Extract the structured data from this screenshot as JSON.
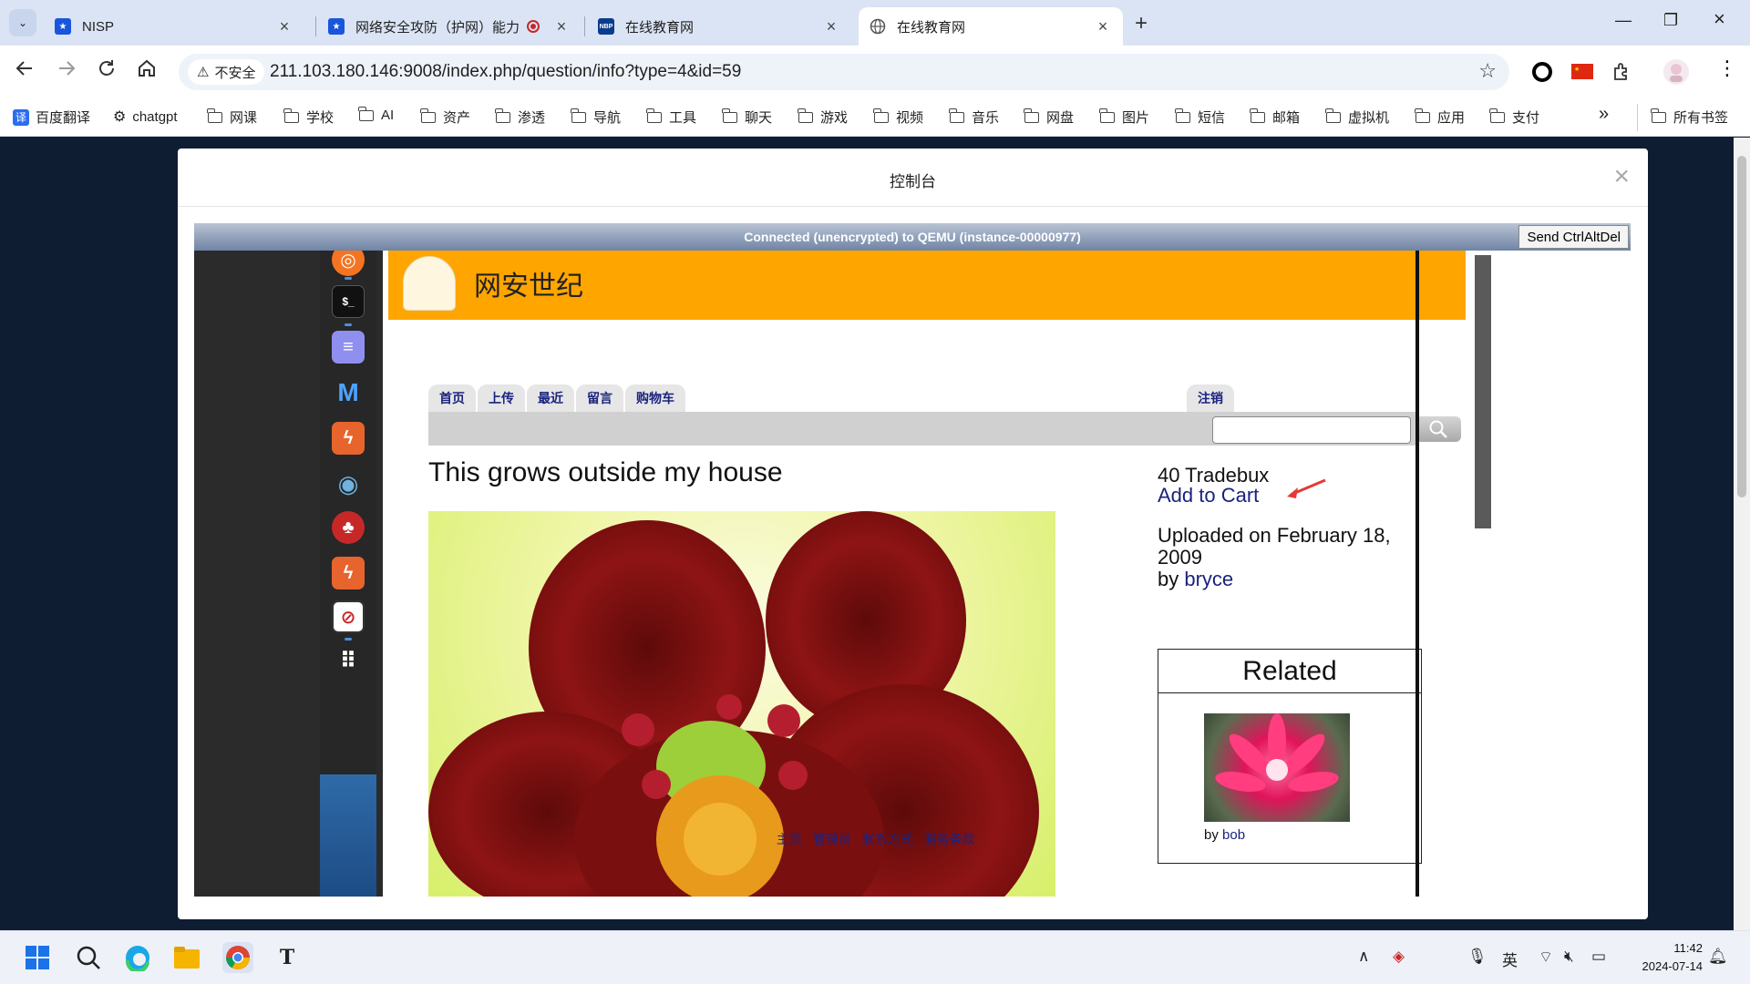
{
  "browser": {
    "tabs": [
      {
        "title": "NISP",
        "favicon_color": "#1a56db"
      },
      {
        "title": "网络安全攻防（护网）能力",
        "favicon_color": "#1a56db",
        "recording": true
      },
      {
        "title": "在线教育网",
        "favicon_label": "NBP",
        "favicon_color": "#0a3c8c"
      },
      {
        "title": "在线教育网",
        "active": true
      }
    ],
    "omnibox": {
      "insecure_label": "不安全",
      "url": "211.103.180.146:9008/index.php/question/info?type=4&id=59"
    },
    "bookmarks": [
      {
        "label": "百度翻译",
        "kind": "translate-icon"
      },
      {
        "label": "chatgpt",
        "kind": "openai-icon"
      },
      {
        "label": "网课",
        "kind": "folder"
      },
      {
        "label": "学校",
        "kind": "folder"
      },
      {
        "label": "AI",
        "kind": "folder"
      },
      {
        "label": "资产",
        "kind": "folder"
      },
      {
        "label": "渗透",
        "kind": "folder"
      },
      {
        "label": "导航",
        "kind": "folder"
      },
      {
        "label": "工具",
        "kind": "folder"
      },
      {
        "label": "聊天",
        "kind": "folder"
      },
      {
        "label": "游戏",
        "kind": "folder"
      },
      {
        "label": "视频",
        "kind": "folder"
      },
      {
        "label": "音乐",
        "kind": "folder"
      },
      {
        "label": "网盘",
        "kind": "folder"
      },
      {
        "label": "图片",
        "kind": "folder"
      },
      {
        "label": "短信",
        "kind": "folder"
      },
      {
        "label": "邮箱",
        "kind": "folder"
      },
      {
        "label": "虚拟机",
        "kind": "folder"
      },
      {
        "label": "应用",
        "kind": "folder"
      },
      {
        "label": "支付",
        "kind": "folder"
      }
    ],
    "overflow_label": "»",
    "all_bookmarks_label": "所有书签"
  },
  "modal": {
    "title": "控制台",
    "close_glyph": "×"
  },
  "vnc": {
    "status": "Connected (unencrypted) to QEMU (instance-00000977)",
    "send_button": "Send CtrlAltDel"
  },
  "guest_page": {
    "site_name": "网安世纪",
    "nav_tabs": [
      "首页",
      "上传",
      "最近",
      "留言",
      "购物车"
    ],
    "logout_tab": "注销",
    "search_value": "",
    "photo_title": "This grows outside my house",
    "price": "40 Tradebux",
    "add_to_cart": "Add to Cart",
    "uploaded_prefix": "Uploaded on February 18, 2009",
    "by_prefix": "by",
    "uploader": "bryce",
    "related_heading": "Related",
    "related_by_prefix": "by",
    "related_user": "bob",
    "footer_links": [
      "主页",
      "管理员",
      "联系方式",
      "服务条款"
    ]
  },
  "taskbar": {
    "ime_label": "英",
    "time": "11:42",
    "date": "2024-07-14"
  },
  "colors": {
    "guest_header": "#ffa500",
    "guest_link": "#1a237e",
    "vnc_bar_top": "#b9c3d3",
    "vnc_bar_bottom": "#6f84a5",
    "page_background": "#0f1d33"
  }
}
